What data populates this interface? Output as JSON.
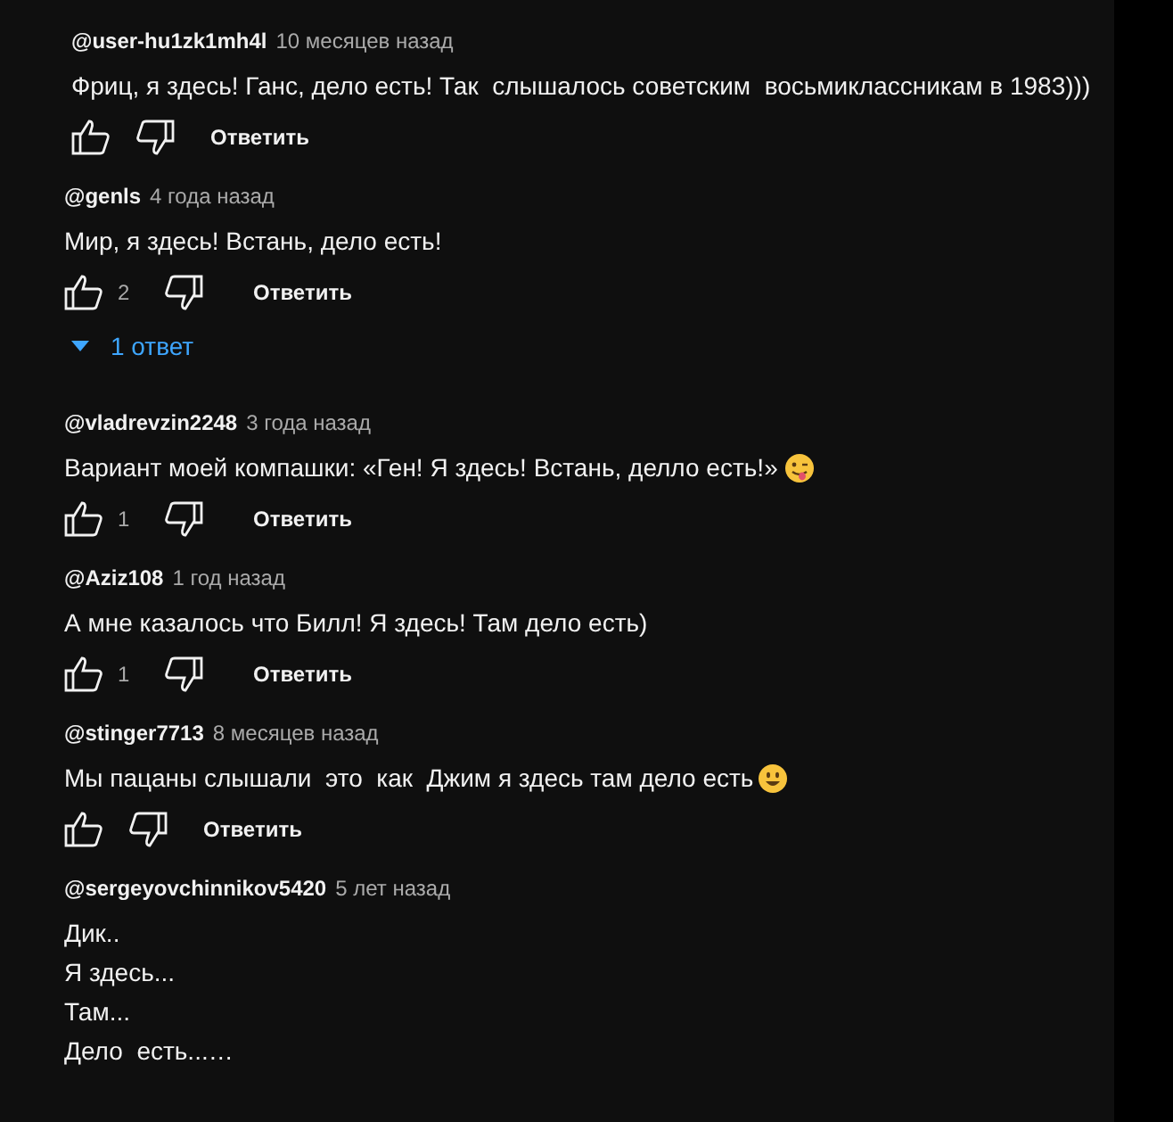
{
  "comments": [
    {
      "author": "@user-hu1zk1mh4l",
      "time": "10 месяцев назад",
      "text": "Фриц, я здесь! Ганс, дело есть! Так  слышалось советским  восьмиклассникам в 1983)))",
      "reply_button": "Ответить"
    },
    {
      "author": "@genls",
      "time": "4 года назад",
      "text": "Мир, я здесь! Встань, дело есть!",
      "likes": "2",
      "reply_button": "Ответить",
      "replies": "1 ответ"
    },
    {
      "author": "@vladrevzin2248",
      "time": "3 года назад",
      "text": "Вариант моей компашки: «Ген! Я здесь! Встань, делло есть!»",
      "emoji": {
        "kind": "tongue"
      },
      "likes": "1",
      "reply_button": "Ответить"
    },
    {
      "author": "@Aziz108",
      "time": "1 год назад",
      "text": "А мне казалось что Билл! Я здесь! Там дело есть)",
      "likes": "1",
      "reply_button": "Ответить"
    },
    {
      "author": "@stinger7713",
      "time": "8 месяцев назад",
      "text": "Мы пацаны слышали  это  как  Джим я здесь там дело есть",
      "emoji": {
        "kind": "smile"
      },
      "reply_button": "Ответить"
    },
    {
      "author": "@sergeyovchinnikov5420",
      "time": "5 лет назад",
      "text": "Дик..\nЯ здесь...\nТам...\nДело  есть...…"
    }
  ]
}
